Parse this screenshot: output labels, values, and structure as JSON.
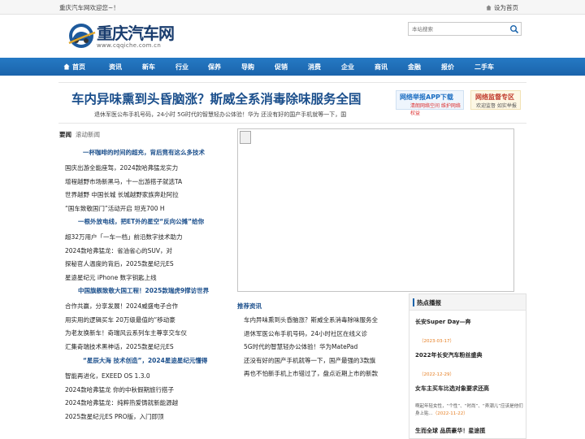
{
  "topbar": {
    "welcome": "重庆汽车网欢迎您~！",
    "home_label": "设为首页"
  },
  "logo": {
    "name": "重庆汽车网",
    "domain": "www.cqqiche.com.cn"
  },
  "search": {
    "placeholder": "本站搜索"
  },
  "nav": [
    "首页",
    "资讯",
    "新车",
    "行业",
    "保养",
    "导购",
    "促销",
    "消费",
    "企业",
    "商讯",
    "金融",
    "报价",
    "二手车"
  ],
  "headline": "车内异味熏到头昏脑涨？斯威全系消毒除味服务全国",
  "subline": "退休军医公布手机号码，24小时   5G时代的智慧轻办公体验！华为   还没有好的国产手机就等一下，国",
  "promo1": {
    "title": "网络举报APP下载",
    "sub": "清朗网络空间   维护网络权益"
  },
  "promo2": {
    "title": "网络监督专区",
    "sub": "欢迎监督   如实举报"
  },
  "news_tabs": {
    "active": "要闻",
    "other": "滚动新闻"
  },
  "left_groups": [
    {
      "head": "一杯咖啡的时间的超充，背后竟有这么多技术",
      "items": [
        "国庆出游全能座驾，2024款哈弗猛龙实力",
        "增程越野市场新黑马，十一出游搭子就选TA",
        "世界越野 中国长城 长城越野家族奔赴阿拉",
        "“国车致敬国门”活动开启 坦克700 H"
      ]
    },
    {
      "head": "一根外放电线，把ET外的星空“反向公摊”给你",
      "items": [
        "超32万用户「一车一档」前沿数字技术助力",
        "2024款哈弗猛龙：省油省心的SUV，对",
        "探秘官人温度的背后，2025款星纪元ES",
        "星途星纪元 iPhone 数字钥匙上线"
      ]
    },
    {
      "head": "中国旗舰致敬大国工程！2025款瑞虎9撑访世界",
      "items": [
        "合作共赢，分享发展！2024威盛电子合作",
        "用实用的逻辑买车 20万级最值的“移动豪",
        "为老友换新车！奇瑞风云系列车主尊享交车仪",
        "汇集奇瑞技术黑神话，2025款星纪元ES"
      ]
    },
    {
      "head": "“星辰大海 技术创造”，2024星途星纪元懂得",
      "items": [
        "智能再进化，EXEED OS 1.3.0",
        "2024款哈弗猛龙 你的中秋假期旅行搭子",
        "2024款哈弗猛龙：纯粹热爱铸就新能源越",
        "2025款星纪元ES PRO版，入门即顶"
      ]
    }
  ],
  "recommend": {
    "title": "推荐资讯",
    "items": [
      "车内异味熏到头昏脑涨？斯威全系消毒除味服务全",
      "退休军医公布手机号码，24小时社区在线义诊",
      "5G时代的智慧轻办公体验！华为MatePad",
      "还没有好的国产手机就等一下，国产最强的3款旗",
      "再也不怕新手机上市错过了，盘点近期上市的新款"
    ]
  },
  "hot": {
    "title": "热点播报",
    "items": [
      {
        "title": "长安Super Day—奔",
        "date": "（2023-03-17）"
      },
      {
        "title": "2022年长安汽车粉丝盛典",
        "date": "（2022-12-29）"
      },
      {
        "title": "女车主买车比选对象要求还高",
        "desc": "啊起年轻女性，“个性”、“时尚”、“弄潮儿”应该是他们身上贴...",
        "date": "（2022-11-22）"
      },
      {
        "title": "生而全球 品质豪华！星途揽",
        "date": ""
      }
    ]
  }
}
